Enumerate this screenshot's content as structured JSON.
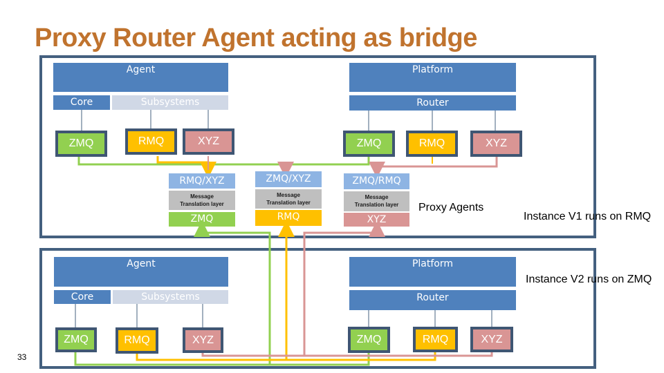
{
  "title": "Proxy Router Agent acting as bridge",
  "page_number": "33",
  "instance_v1": {
    "label": "Instance V1 runs on RMQ",
    "agent": {
      "label": "Agent",
      "core": "Core",
      "subsystems": "Subsystems"
    },
    "platform": {
      "label": "Platform",
      "router": "Router"
    },
    "agent_protocols": [
      "ZMQ",
      "RMQ",
      "XYZ"
    ],
    "router_protocols": [
      "ZMQ",
      "RMQ",
      "XYZ"
    ]
  },
  "proxy_agents": {
    "label": "Proxy Agents",
    "items": [
      {
        "top": "RMQ/XYZ",
        "layer": "Message Translation layer",
        "bottom": "ZMQ"
      },
      {
        "top": "ZMQ/XYZ",
        "layer": "Message Translation layer",
        "bottom": "RMQ"
      },
      {
        "top": "ZMQ/RMQ",
        "layer": "Message Translation layer",
        "bottom": "XYZ"
      }
    ]
  },
  "instance_v2": {
    "label": "Instance V2 runs on ZMQ",
    "agent": {
      "label": "Agent",
      "core": "Core",
      "subsystems": "Subsystems"
    },
    "platform": {
      "label": "Platform",
      "router": "Router"
    },
    "agent_protocols": [
      "ZMQ",
      "RMQ",
      "XYZ"
    ],
    "router_protocols": [
      "ZMQ",
      "RMQ",
      "XYZ"
    ]
  },
  "colors": {
    "zmq": "#92d050",
    "rmq": "#ffc000",
    "xyz": "#d99594",
    "block": "#4f81bd",
    "frame": "#44607f",
    "title": "#c0732e"
  }
}
